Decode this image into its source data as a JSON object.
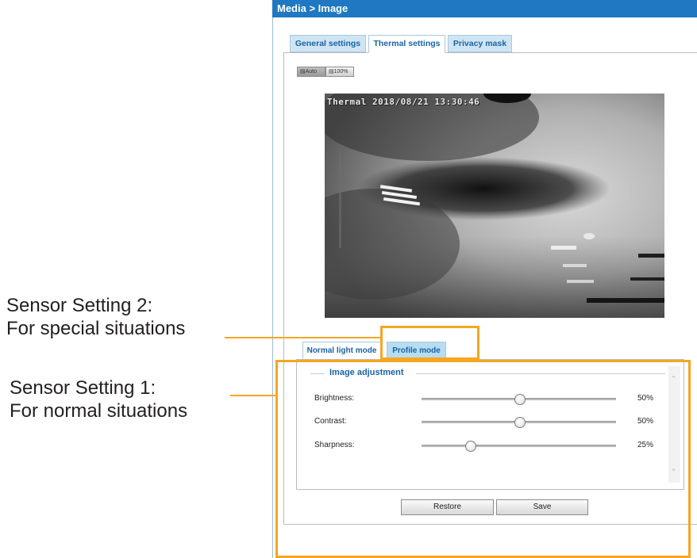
{
  "header": {
    "title": "Media  > Image"
  },
  "tabs": [
    {
      "label": "General settings"
    },
    {
      "label": "Thermal settings"
    },
    {
      "label": "Privacy mask"
    }
  ],
  "view_buttons": [
    {
      "label": "Auto",
      "icon": "fit-icon"
    },
    {
      "label": "100%",
      "icon": "actual-size-icon"
    }
  ],
  "preview": {
    "timestamp": "Thermal 2018/08/21 13:30:46"
  },
  "sub_tabs": [
    {
      "label": "Normal light mode"
    },
    {
      "label": "Profile mode"
    }
  ],
  "image_adjustment": {
    "legend": "Image adjustment",
    "rows": [
      {
        "label": "Brightness:",
        "value": "50%",
        "level": 0.5
      },
      {
        "label": "Contrast:",
        "value": "50%",
        "level": 0.5
      },
      {
        "label": "Sharpness:",
        "value": "25%",
        "level": 0.25
      }
    ]
  },
  "buttons": {
    "restore": "Restore",
    "save": "Save"
  },
  "callouts": {
    "setting2_line1": "Sensor Setting 2:",
    "setting2_line2": "For special situations",
    "setting1_line1": "Sensor Setting 1:",
    "setting1_line2": "For normal situations"
  },
  "colors": {
    "header": "#1f78c1",
    "accent": "#1a63a8",
    "highlight": "#f5a623"
  }
}
